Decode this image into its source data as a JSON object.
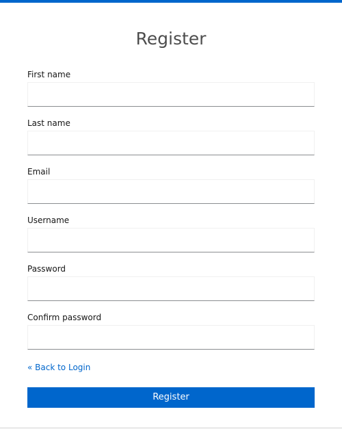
{
  "header": {
    "title": "Register"
  },
  "form": {
    "fields": [
      {
        "label": "First name",
        "value": "",
        "placeholder": ""
      },
      {
        "label": "Last name",
        "value": "",
        "placeholder": ""
      },
      {
        "label": "Email",
        "value": "",
        "placeholder": ""
      },
      {
        "label": "Username",
        "value": "",
        "placeholder": ""
      },
      {
        "label": "Password",
        "value": "",
        "placeholder": ""
      },
      {
        "label": "Confirm password",
        "value": "",
        "placeholder": ""
      }
    ],
    "back_link": "« Back to Login",
    "submit_label": "Register"
  },
  "colors": {
    "accent": "#0066cc",
    "title": "#4d4d4d",
    "text": "#151515",
    "input_border_bottom": "#8a8d90"
  }
}
